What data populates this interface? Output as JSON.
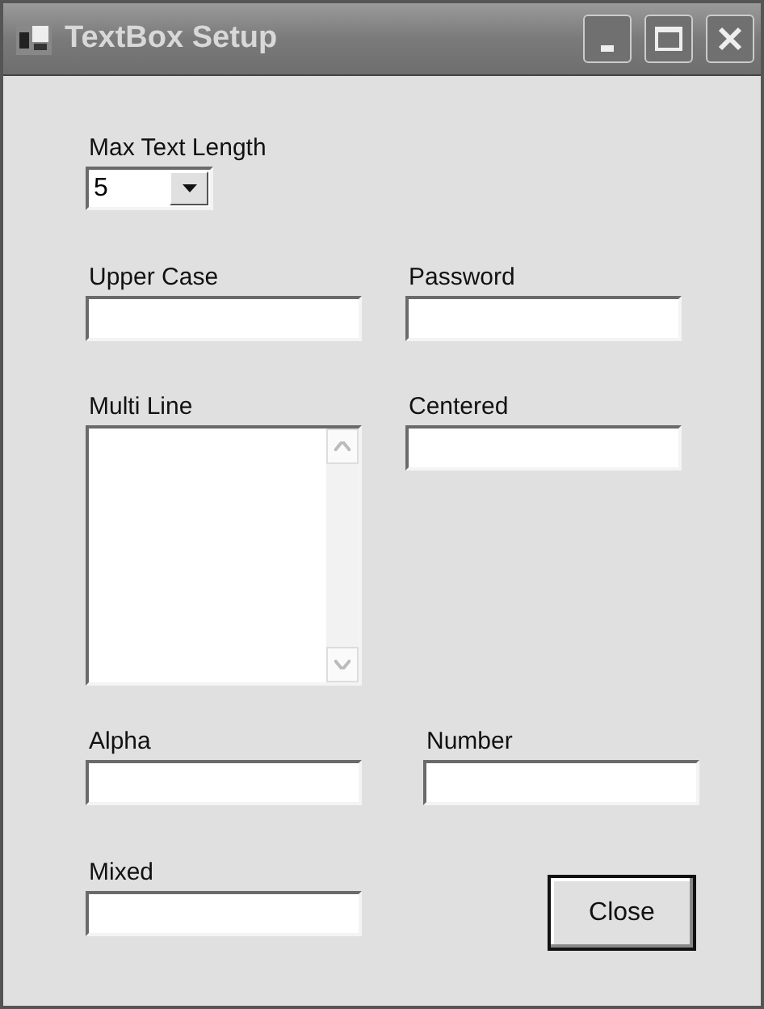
{
  "window": {
    "title": "TextBox Setup"
  },
  "max_text_length": {
    "label": "Max Text Length",
    "value": "5"
  },
  "rows": [
    {
      "fields": [
        {
          "label": "Upper Case",
          "kind": "text"
        },
        {
          "label": "Password",
          "kind": "text"
        }
      ]
    },
    {
      "fields": [
        {
          "label": "Multi Line",
          "kind": "multiline"
        },
        {
          "label": "Centered",
          "kind": "text"
        }
      ]
    },
    {
      "fields": [
        {
          "label": "Alpha",
          "kind": "text"
        },
        {
          "label": "Number",
          "kind": "text"
        }
      ]
    },
    {
      "fields": [
        {
          "label": "Mixed",
          "kind": "text"
        }
      ]
    }
  ],
  "buttons": [
    {
      "label": "Close"
    }
  ]
}
